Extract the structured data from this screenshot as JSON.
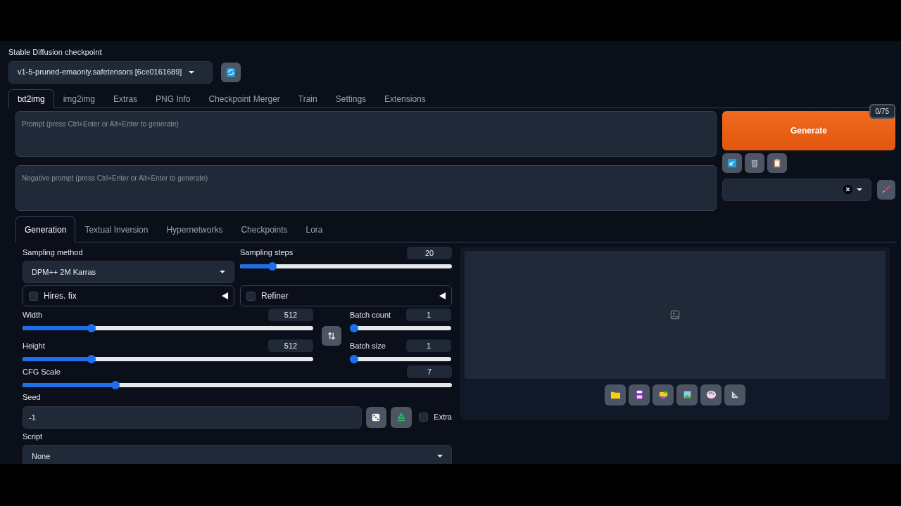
{
  "checkpoint": {
    "label": "Stable Diffusion checkpoint",
    "value": "v1-5-pruned-emaonly.safetensors [6ce0161689]"
  },
  "tabs": [
    {
      "label": "txt2img",
      "selected": true
    },
    {
      "label": "img2img",
      "selected": false
    },
    {
      "label": "Extras",
      "selected": false
    },
    {
      "label": "PNG Info",
      "selected": false
    },
    {
      "label": "Checkpoint Merger",
      "selected": false
    },
    {
      "label": "Train",
      "selected": false
    },
    {
      "label": "Settings",
      "selected": false
    },
    {
      "label": "Extensions",
      "selected": false
    }
  ],
  "prompt": {
    "placeholder": "Prompt (press Ctrl+Enter or Alt+Enter to generate)",
    "token_count": "0/75"
  },
  "negative_prompt": {
    "placeholder": "Negative prompt (press Ctrl+Enter or Alt+Enter to generate)"
  },
  "generate_button": "Generate",
  "subtabs": [
    {
      "label": "Generation",
      "selected": true
    },
    {
      "label": "Textual Inversion",
      "selected": false
    },
    {
      "label": "Hypernetworks",
      "selected": false
    },
    {
      "label": "Checkpoints",
      "selected": false
    },
    {
      "label": "Lora",
      "selected": false
    }
  ],
  "sampling_method": {
    "label": "Sampling method",
    "value": "DPM++ 2M Karras"
  },
  "sampling_steps": {
    "label": "Sampling steps",
    "value": "20",
    "level": 0.14
  },
  "accordions": [
    {
      "label": "Hires. fix",
      "checked": false
    },
    {
      "label": "Refiner",
      "checked": false
    }
  ],
  "width": {
    "label": "Width",
    "value": "512",
    "level": 0.23
  },
  "height": {
    "label": "Height",
    "value": "512",
    "level": 0.23
  },
  "batch_count": {
    "label": "Batch count",
    "value": "1",
    "level": 0
  },
  "batch_size": {
    "label": "Batch size",
    "value": "1",
    "level": 0
  },
  "cfg_scale": {
    "label": "CFG Scale",
    "value": "7",
    "level": 0.21
  },
  "seed": {
    "label": "Seed",
    "value": "-1"
  },
  "extra": {
    "label": "Extra",
    "checked": false
  },
  "script": {
    "label": "Script",
    "value": "None"
  }
}
